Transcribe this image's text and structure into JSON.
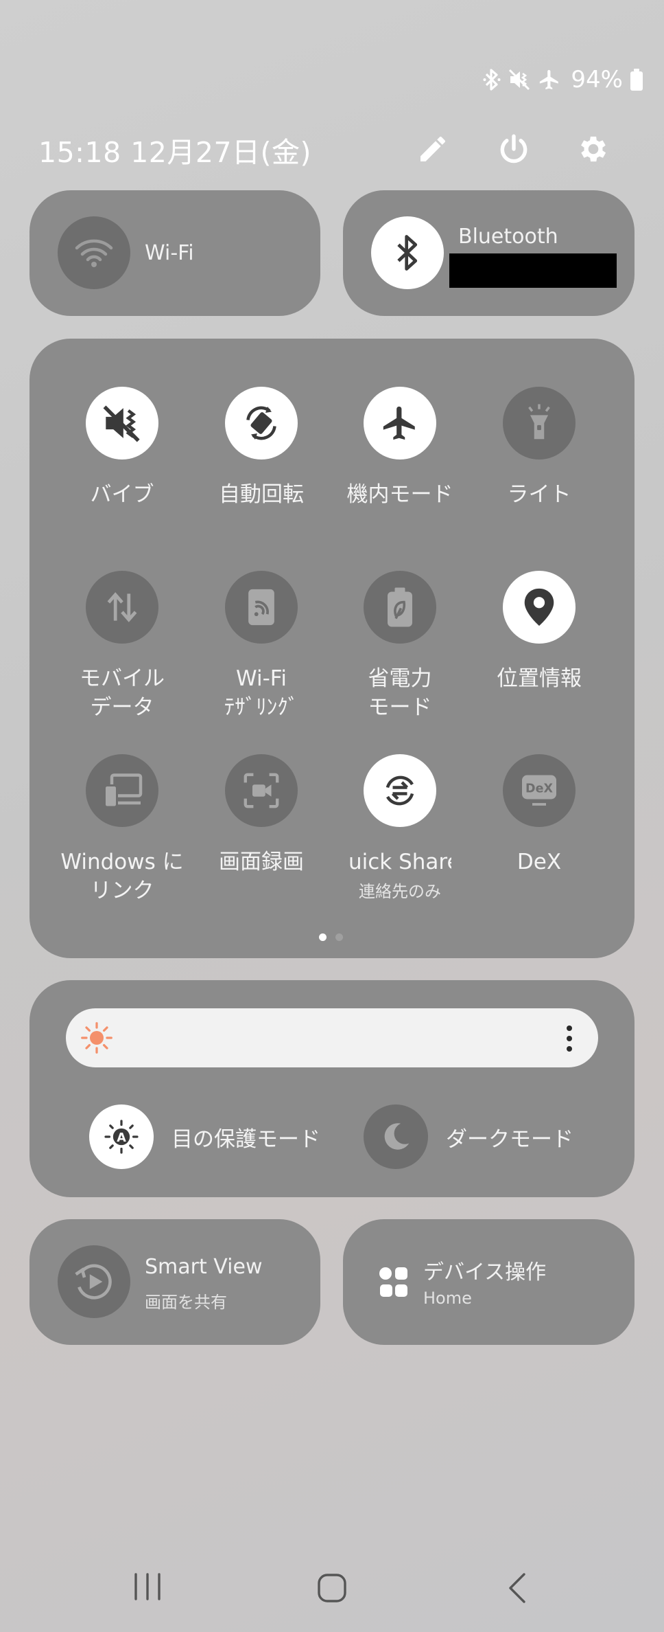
{
  "status_bar": {
    "battery_percent": "94%",
    "battery_level": 0.94
  },
  "header": {
    "time_date": "15:18  12月27日(金)"
  },
  "wifi_tile": {
    "label": "Wi-Fi"
  },
  "bluetooth_tile": {
    "label": "Bluetooth"
  },
  "quick_tiles": [
    {
      "label": "バイブ",
      "state": "on",
      "icon": "vibrate-mute-icon"
    },
    {
      "label": "自動回転",
      "state": "on",
      "icon": "auto-rotate-icon"
    },
    {
      "label": "機内モード",
      "state": "on",
      "icon": "airplane-icon"
    },
    {
      "label": "ライト",
      "state": "off",
      "icon": "flashlight-icon"
    },
    {
      "label": "モバイル\nデータ",
      "state": "off",
      "icon": "mobile-data-icon"
    },
    {
      "label": "Wi-Fi\nﾃｻﾞﾘﾝｸﾞ",
      "state": "off",
      "icon": "hotspot-icon"
    },
    {
      "label": "省電力\nモード",
      "state": "off",
      "icon": "power-saving-icon"
    },
    {
      "label": "位置情報",
      "state": "on",
      "icon": "location-icon"
    },
    {
      "label": "Windows に\nリンク",
      "state": "off",
      "icon": "link-to-windows-icon"
    },
    {
      "label": "画面録画",
      "state": "off",
      "icon": "screen-record-icon"
    },
    {
      "label": "uick Share",
      "sub": "連絡先のみ",
      "state": "on",
      "icon": "quick-share-icon"
    },
    {
      "label": "DeX",
      "state": "off",
      "icon": "dex-icon"
    }
  ],
  "brightness": {
    "level": 0.0
  },
  "eye_comfort": {
    "label": "目の保護モード"
  },
  "dark_mode": {
    "label": "ダークモード"
  },
  "smart_view": {
    "label": "Smart View",
    "sub": "画面を共有"
  },
  "device_control": {
    "label": "デバイス操作",
    "sub": "Home"
  },
  "colors": {
    "panel": "#8b8b8b",
    "tile_off": "#6e6e6e",
    "tile_on": "#ffffff",
    "brightness_sun": "#f4906b"
  }
}
